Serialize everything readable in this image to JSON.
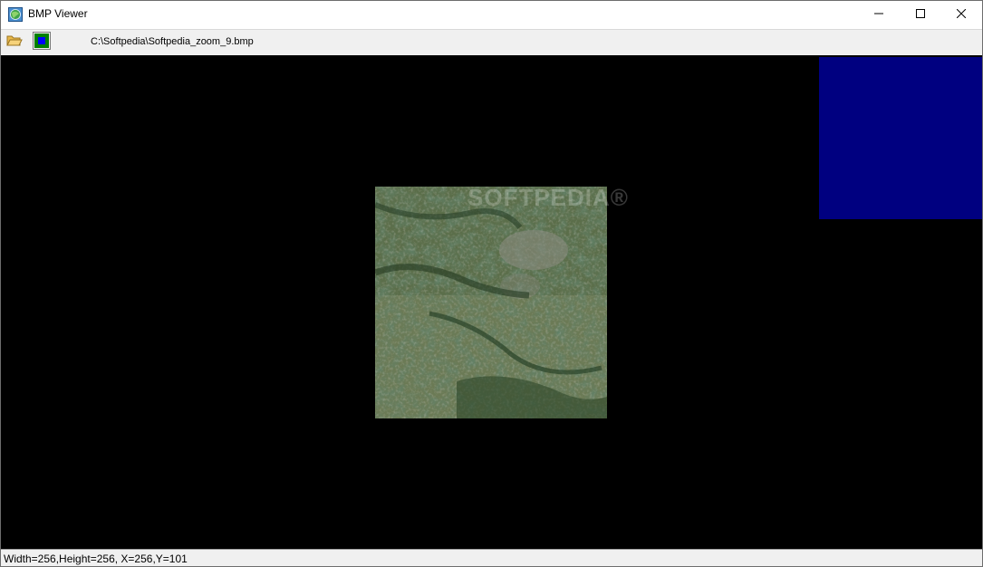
{
  "window": {
    "title": "BMP Viewer",
    "app_icon": "bmp-viewer-app-icon",
    "controls": {
      "minimize": "minimize-icon",
      "maximize": "maximize-icon",
      "close": "close-icon"
    }
  },
  "toolbar": {
    "open_icon": "open-folder-icon",
    "color_icon": "color-swatch-icon",
    "file_path": "C:\\Softpedia\\Softpedia_zoom_9.bmp"
  },
  "canvas": {
    "background": "#000000",
    "color_swatch": "#000080",
    "watermark": "SOFTPEDIA®"
  },
  "status": {
    "text": "Width=256,Height=256, X=256,Y=101"
  }
}
